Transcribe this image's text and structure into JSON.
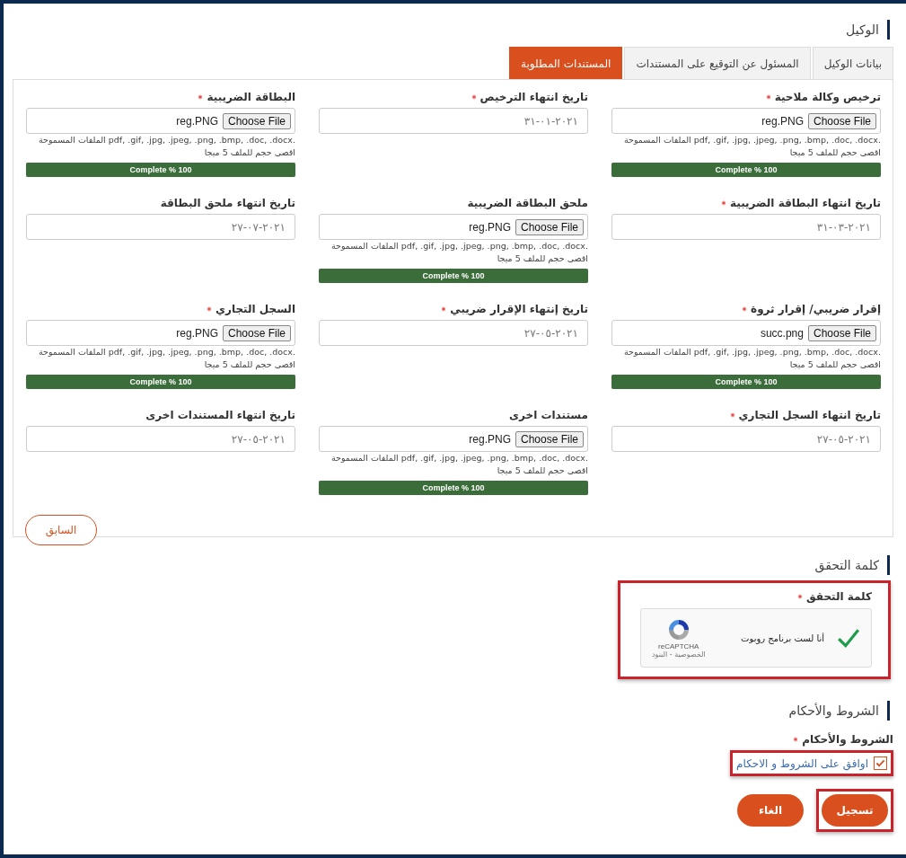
{
  "section_title": "الوكيل",
  "tabs": [
    {
      "label": "بيانات الوكيل",
      "selected": false
    },
    {
      "label": "المسئول عن التوقيع على المستندات",
      "selected": false
    },
    {
      "label": "المستندات المطلوبة",
      "selected": true
    }
  ],
  "fields": [
    {
      "kind": "file",
      "label": "ترخيص وكالة ملاحية",
      "required": true,
      "button": "Choose File",
      "file_name": "reg.PNG",
      "allowed": ".pdf, .gif, .jpg, .jpeg, .png, .bmp, .doc, .docx الملفات المسموحة",
      "max_size": "اقصى حجم للملف 5 ميجا",
      "progress": "Complete % 100",
      "level": 1
    },
    {
      "kind": "date",
      "label": "تاريخ انتهاء الترخيص",
      "required": true,
      "value": "٣١-٠١-٢٠٢١"
    },
    {
      "kind": "file",
      "label": "البطاقة الضريبية",
      "required": true,
      "button": "Choose File",
      "file_name": "reg.PNG",
      "allowed": ".pdf, .gif, .jpg, .jpeg, .png, .bmp, .doc, .docx الملفات المسموحة",
      "max_size": "اقصى حجم للملف 5 ميجا",
      "progress": "Complete % 100",
      "level": 1
    },
    {
      "kind": "date",
      "label": "تاريخ انتهاء البطاقة الضريبية",
      "required": true,
      "value": "٣١-٠٣-٢٠٢١"
    },
    {
      "kind": "file",
      "label": "ملحق البطاقة الضريبية",
      "required": false,
      "button": "Choose File",
      "file_name": "reg.PNG",
      "allowed": ".pdf, .gif, .jpg, .jpeg, .png, .bmp, .doc, .docx الملفات المسموحة",
      "max_size": "اقصى حجم للملف 5 ميجا",
      "progress": "Complete % 100",
      "level": 1
    },
    {
      "kind": "date",
      "label": "تاريخ انتهاء ملحق البطاقة",
      "required": false,
      "value": "٢٧-٠٧-٢٠٢١"
    },
    {
      "kind": "file",
      "label": "إقرار ضريبي/ إقرار ثروة",
      "required": true,
      "button": "Choose File",
      "file_name": "succ.png",
      "allowed": ".pdf, .gif, .jpg, .jpeg, .png, .bmp, .doc, .docx الملفات المسموحة",
      "max_size": "اقصى حجم للملف 5 ميجا",
      "progress": "Complete % 100",
      "level": 1
    },
    {
      "kind": "date",
      "label": "تاريخ إنتهاء الإقرار ضريبي",
      "required": true,
      "value": "٢٧-٠٥-٢٠٢١"
    },
    {
      "kind": "file",
      "label": "السجل التجاري",
      "required": true,
      "button": "Choose File",
      "file_name": "reg.PNG",
      "allowed": ".pdf, .gif, .jpg, .jpeg, .png, .bmp, .doc, .docx الملفات المسموحة",
      "max_size": "اقصى حجم للملف 5 ميجا",
      "progress": "Complete % 100",
      "level": 1
    },
    {
      "kind": "date",
      "label": "تاريخ انتهاء السجل التجاري",
      "required": true,
      "value": "٢٧-٠٥-٢٠٢١"
    },
    {
      "kind": "file",
      "label": "مستندات اخرى",
      "required": false,
      "button": "Choose File",
      "file_name": "reg.PNG",
      "allowed": ".pdf, .gif, .jpg, .jpeg, .png, .bmp, .doc, .docx الملفات المسموحة",
      "max_size": "اقصى حجم للملف 5 ميجا",
      "progress": "Complete % 100",
      "level": 1
    },
    {
      "kind": "date",
      "label": "تاريخ انتهاء المستندات اخرى",
      "required": false,
      "value": "٢٧-٠٥-٢٠٢١"
    }
  ],
  "previous_button": "السابق",
  "captcha": {
    "section_title": "كلمة التحقق",
    "label": "كلمة التحقق",
    "required": true,
    "checked": true,
    "text": "أنا لست برنامج روبوت",
    "brand": "reCAPTCHA",
    "links": "الخصوصية - البنود",
    "highlighted": true
  },
  "terms": {
    "section_title": "الشروط والأحكام",
    "label": "الشروط والأحكام",
    "required": true,
    "checkbox_label": "اوافق على الشروط و الاحكام",
    "checked": true,
    "highlighted": true
  },
  "buttons": [
    {
      "label": "تسجيل",
      "highlighted": true
    },
    {
      "label": "الغاء",
      "highlighted": false
    }
  ]
}
